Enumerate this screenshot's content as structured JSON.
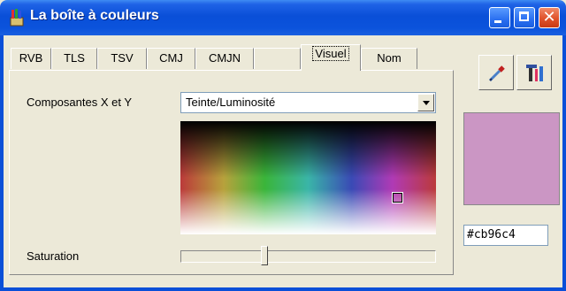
{
  "window": {
    "title": "La boîte à couleurs",
    "icon": "paint-brushes-icon"
  },
  "tabs": [
    {
      "label": "RVB",
      "active": false
    },
    {
      "label": "TLS",
      "active": false
    },
    {
      "label": "TSV",
      "active": false
    },
    {
      "label": "CMJ",
      "active": false
    },
    {
      "label": "CMJN",
      "active": false
    },
    {
      "label": "Visuel",
      "active": true
    },
    {
      "label": "Nom",
      "active": false
    }
  ],
  "visuel": {
    "components_label": "Composantes X et Y",
    "components_value": "Teinte/Luminosité",
    "saturation_label": "Saturation",
    "saturation_level": 0.33
  },
  "tools": {
    "picker_icon": "eyedropper-icon",
    "wand_icon": "wand-icon"
  },
  "color": {
    "hex": "#cb96c4",
    "swatch": "#cb96c4"
  }
}
